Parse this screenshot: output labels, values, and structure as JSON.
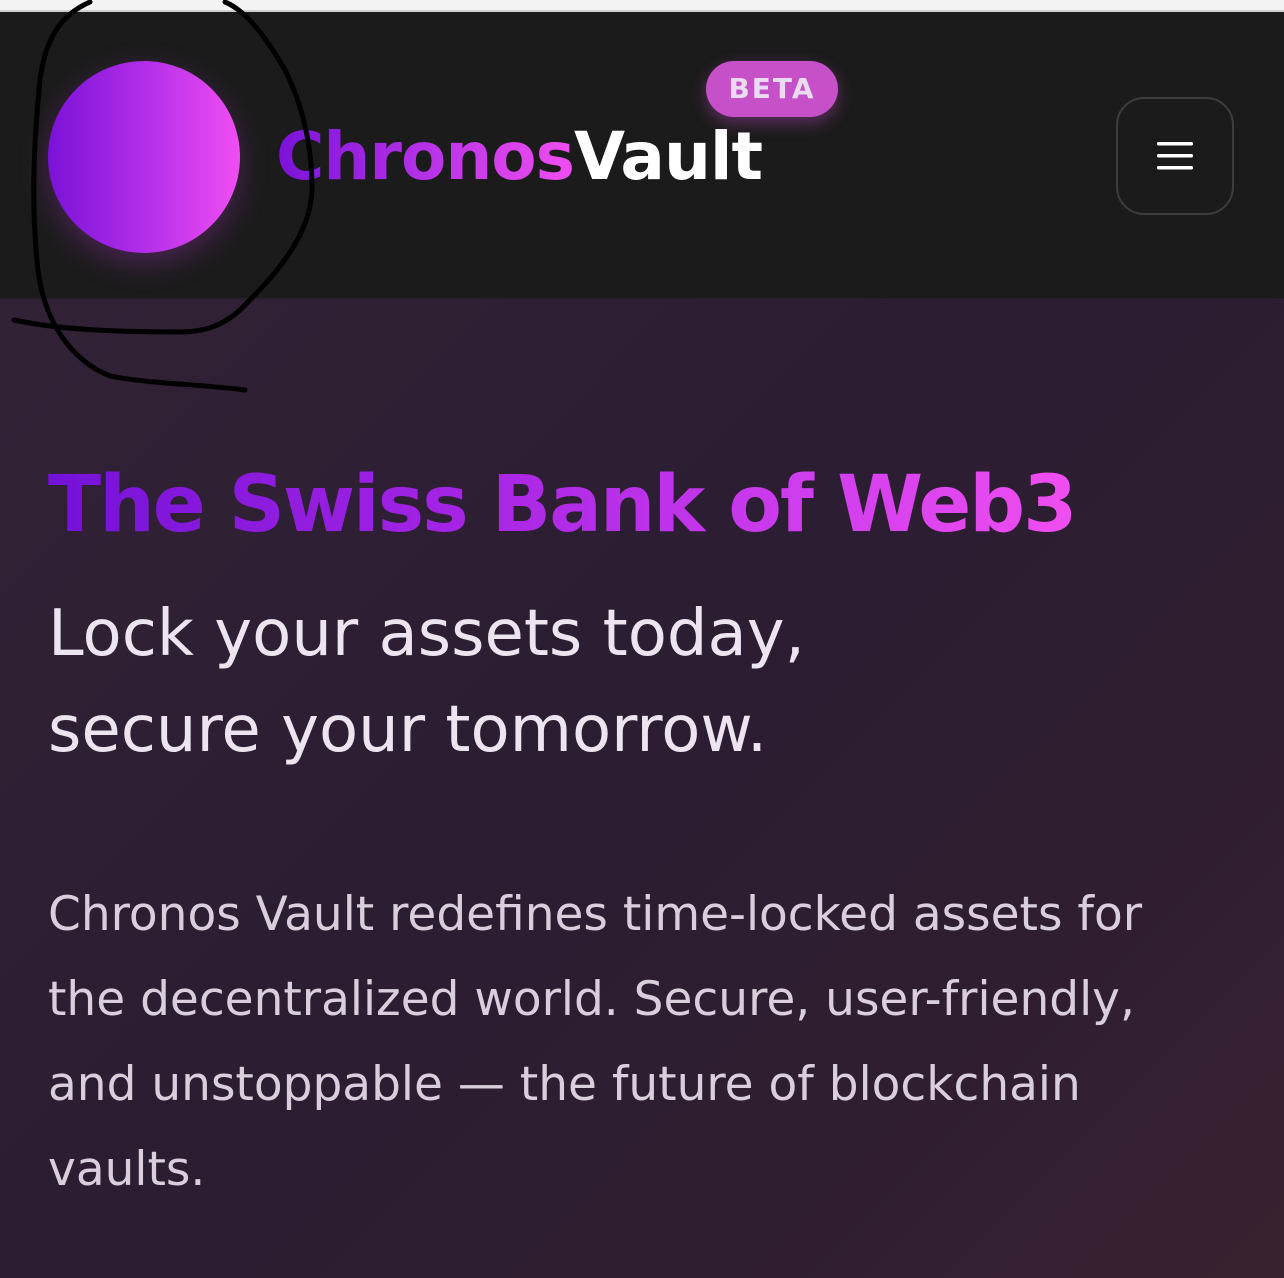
{
  "header": {
    "brand_part1": "Chronos",
    "brand_part2": "Vault",
    "beta_badge": "BETA",
    "menu_icon": "hamburger-menu-icon"
  },
  "hero": {
    "headline": "The Swiss Bank of Web3",
    "tagline_line1": "Lock your assets today,",
    "tagline_line2": "secure your tomorrow.",
    "description": "Chronos Vault redefines time-locked assets for the decentralized world. Secure, user-friendly, and unstoppable — the future of blockchain vaults."
  },
  "colors": {
    "header_bg": "#1b1b1b",
    "hero_bg": "#2b1d32",
    "gradient_start": "#7412d8",
    "gradient_end": "#f04ef0",
    "beta_bg": "#c550c8",
    "annotation_stroke": "#000000"
  }
}
